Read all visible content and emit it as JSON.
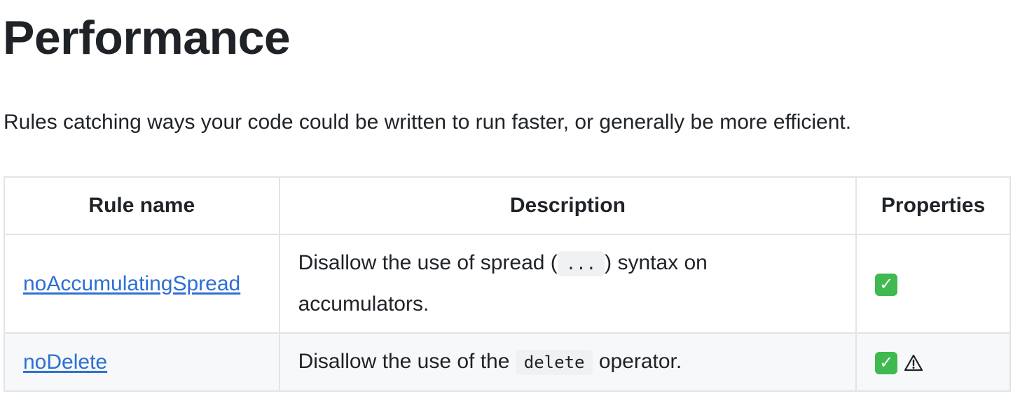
{
  "page": {
    "title": "Performance",
    "intro": "Rules catching ways your code could be written to run faster, or generally be more efficient."
  },
  "table": {
    "headers": {
      "rule_name": "Rule name",
      "description": "Description",
      "properties": "Properties"
    },
    "rows": [
      {
        "name": "noAccumulatingSpread",
        "description_before": "Disallow the use of spread (",
        "description_code": "...",
        "description_after": ") syntax on accumulators.",
        "properties": [
          "check-icon"
        ]
      },
      {
        "name": "noDelete",
        "description_before": "Disallow the use of the",
        "description_code": "delete",
        "description_after": "operator.",
        "properties": [
          "check-icon",
          "warning-icon"
        ]
      }
    ]
  },
  "colors": {
    "link": "#2f6fd1",
    "check": "#3fb950",
    "border": "#e1e4e8",
    "row_alt": "#f6f8fa"
  }
}
